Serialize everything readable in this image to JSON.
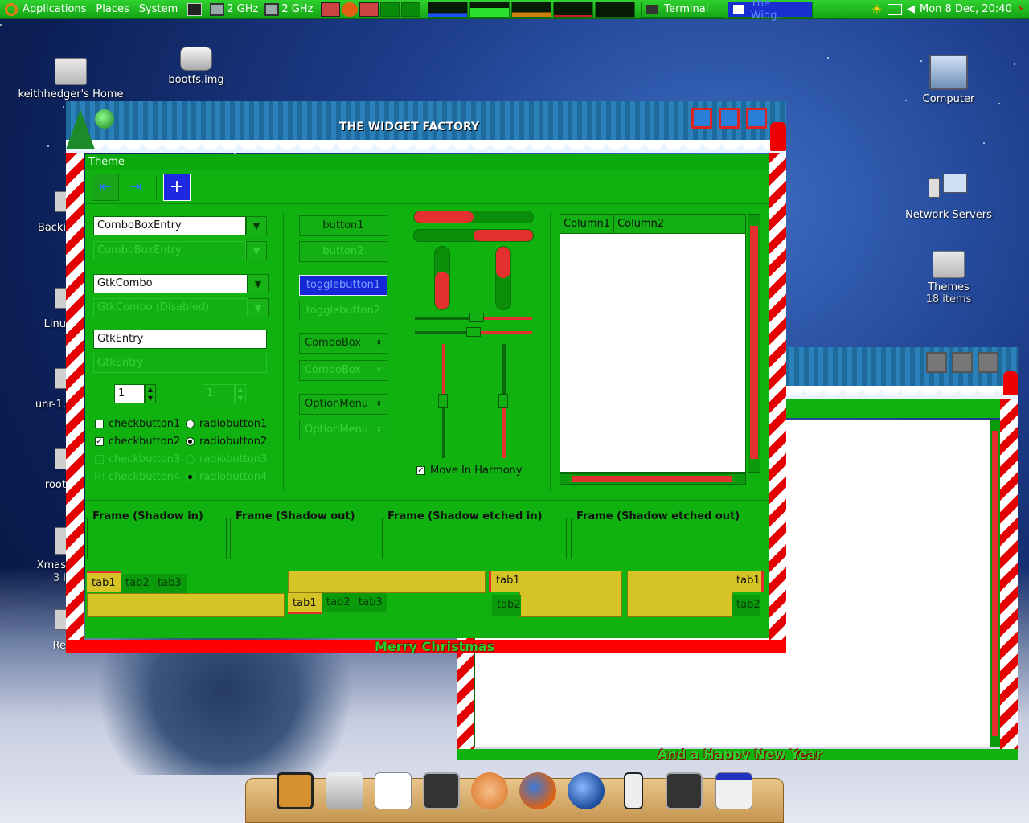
{
  "panel": {
    "menus": [
      "Applications",
      "Places",
      "System"
    ],
    "cpu1": "2 GHz",
    "cpu2": "2 GHz",
    "tasks": [
      "Terminal",
      "The Widg..."
    ],
    "clock": "Mon  8 Dec, 20:40"
  },
  "desktop": {
    "icons": {
      "home": "keithhedger's Home",
      "bootfs": "bootfs.img",
      "computer": "Computer",
      "network": "Network Servers",
      "themes": "Themes",
      "themes_sub": "18 items"
    },
    "partial_labels": [
      "Backi",
      "Linu",
      "unr-1.",
      "root",
      "Xmas",
      "3 i",
      "Re"
    ]
  },
  "widget_factory": {
    "title": "THE WIDGET FACTORY",
    "menu": "Theme",
    "combo_entry": "ComboBoxEntry",
    "combo_entry_dis": "ComboBoxEntry",
    "gtk_combo": "GtkCombo",
    "gtk_combo_dis": "GtkCombo (Disabled)",
    "entry": "GtkEntry",
    "entry_dis": "GtkEntry",
    "spin": "1",
    "spin_dis": "1",
    "checks": [
      "checkbutton1",
      "checkbutton2",
      "checkbutton3",
      "checkbutton4"
    ],
    "radios": [
      "radiobutton1",
      "radiobutton2",
      "radiobutton3",
      "radiobutton4"
    ],
    "button1": "button1",
    "button2": "button2",
    "toggle1": "togglebutton1",
    "toggle2": "togglebutton2",
    "combobox": "ComboBox",
    "combobox_dis": "ComboBox",
    "optionmenu": "OptionMenu",
    "optionmenu_dis": "OptionMenu",
    "move_harmony": "Move In Harmony",
    "col1": "Column1",
    "col2": "Column2",
    "frames": [
      "Frame (Shadow in)",
      "Frame (Shadow out)",
      "Frame (Shadow etched in)",
      "Frame (Shadow etched out)"
    ],
    "tabs": [
      "tab1",
      "tab2",
      "tab3"
    ],
    "footer": "Merry Christmas",
    "progress": {
      "h1": 0.5,
      "h2": 0.5,
      "v1": 0.6,
      "v2": 0.5
    }
  },
  "second_window": {
    "footer": "And a Happy New Year"
  },
  "colors": {
    "panel_green": "#1fbd1f",
    "client_green": "#0fb20f",
    "accent_red": "#e53030",
    "tab_yellow": "#d6c325"
  }
}
